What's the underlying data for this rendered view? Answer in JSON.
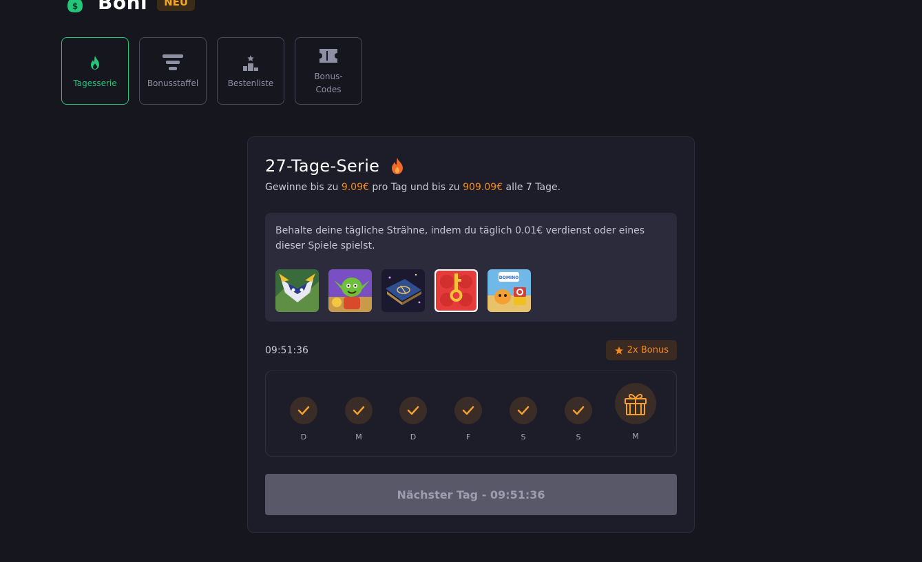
{
  "header": {
    "title": "Boni",
    "badge": "NEU",
    "icon": "money-bag-icon"
  },
  "tabs": [
    {
      "label": "Tagesserie",
      "icon": "flame-icon",
      "active": true
    },
    {
      "label": "Bonusstaffel",
      "icon": "bars-icon",
      "active": false
    },
    {
      "label": "Bestenliste",
      "icon": "podium-icon",
      "active": false
    },
    {
      "label": "Bonus-Codes",
      "icon": "ticket-icon",
      "active": false
    }
  ],
  "streak": {
    "title": "27-Tage-Serie",
    "subtitle_part1": "Gewinne bis zu ",
    "daily_amount": "9.09€",
    "subtitle_part2": " pro Tag und bis zu ",
    "weekly_amount": "909.09€",
    "subtitle_part3": " alle 7 Tage.",
    "info_text": "Behalte deine tägliche Strähne, indem du täglich 0.01€ verdienst oder eines dieser Spiele spielst.",
    "games": [
      "game-warrior-thumbnail",
      "game-goblin-thumbnail",
      "game-spellbook-thumbnail",
      "game-lock-thumbnail",
      "game-domino-dreams-thumbnail"
    ],
    "timer": "09:51:36",
    "bonus_badge": "2x Bonus",
    "days": [
      {
        "label": "D",
        "status": "done"
      },
      {
        "label": "M",
        "status": "done"
      },
      {
        "label": "D",
        "status": "done"
      },
      {
        "label": "F",
        "status": "done"
      },
      {
        "label": "S",
        "status": "done"
      },
      {
        "label": "S",
        "status": "done"
      },
      {
        "label": "M",
        "status": "gift"
      }
    ],
    "next_button": "Nächster Tag - 09:51:36"
  },
  "colors": {
    "background": "#16161f",
    "card": "#1d1d2a",
    "accent_green": "#22c77a",
    "accent_orange": "#f58a1f",
    "button_disabled": "#595868"
  }
}
